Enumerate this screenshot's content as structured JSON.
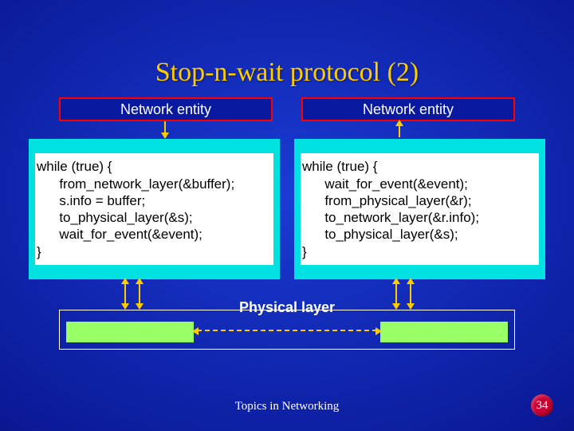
{
  "title": "Stop-n-wait protocol (2)",
  "left_entity": "Network entity",
  "right_entity": "Network entity",
  "left_code": "while (true) {\n      from_network_layer(&buffer);\n      s.info = buffer;\n      to_physical_layer(&s);\n      wait_for_event(&event);\n}",
  "right_code": "while (true) {\n      wait_for_event(&event);\n      from_physical_layer(&r);\n      to_network_layer(&r.info);\n      to_physical_layer(&s);\n}",
  "physical_label": "Physical layer",
  "footer": "Topics in Networking",
  "page": "34"
}
